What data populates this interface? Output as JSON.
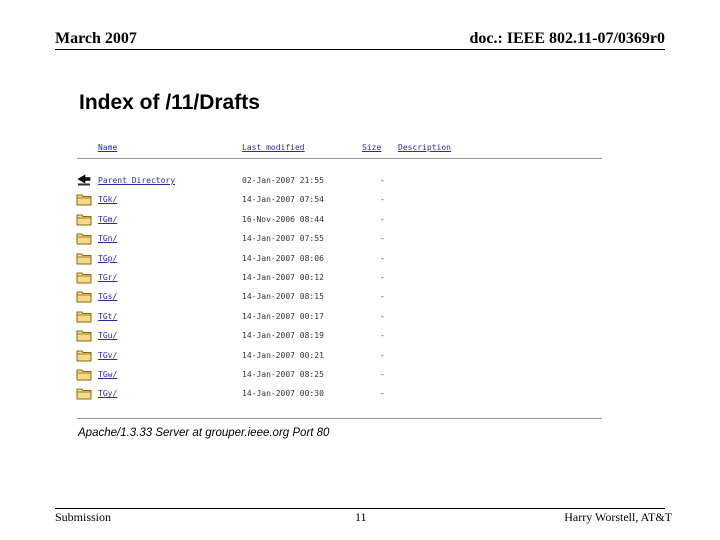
{
  "slide_header": {
    "date": "March 2007",
    "doc_id": "doc.: IEEE 802.11-07/0369r0"
  },
  "index_page": {
    "title": "Index of /11/Drafts",
    "columns": {
      "name": "Name",
      "last_modified": "Last modified",
      "size": "Size",
      "description": "Description"
    },
    "rows": [
      {
        "name": "Parent Directory",
        "modified": "02-Jan-2007 21:55",
        "size": "-",
        "icon": "back-arrow-icon"
      },
      {
        "name": "TGk/",
        "modified": "14-Jan-2007 07:54",
        "size": "-",
        "icon": "folder-icon"
      },
      {
        "name": "TGm/",
        "modified": "16-Nov-2006 08:44",
        "size": "-",
        "icon": "folder-icon"
      },
      {
        "name": "TGn/",
        "modified": "14-Jan-2007 07:55",
        "size": "-",
        "icon": "folder-icon"
      },
      {
        "name": "TGp/",
        "modified": "14-Jan-2007 08:06",
        "size": "-",
        "icon": "folder-icon"
      },
      {
        "name": "TGr/",
        "modified": "14-Jan-2007 00:12",
        "size": "-",
        "icon": "folder-icon"
      },
      {
        "name": "TGs/",
        "modified": "14-Jan-2007 08:15",
        "size": "-",
        "icon": "folder-icon"
      },
      {
        "name": "TGt/",
        "modified": "14-Jan-2007 00:17",
        "size": "-",
        "icon": "folder-icon"
      },
      {
        "name": "TGu/",
        "modified": "14-Jan-2007 08:19",
        "size": "-",
        "icon": "folder-icon"
      },
      {
        "name": "TGv/",
        "modified": "14-Jan-2007 00:21",
        "size": "-",
        "icon": "folder-icon"
      },
      {
        "name": "TGw/",
        "modified": "14-Jan-2007 08:25",
        "size": "-",
        "icon": "folder-icon"
      },
      {
        "name": "TGy/",
        "modified": "14-Jan-2007 00:30",
        "size": "-",
        "icon": "folder-icon"
      }
    ],
    "server_signature": "Apache/1.3.33 Server at grouper.ieee.org Port 80"
  },
  "slide_footer": {
    "left": "Submission",
    "page_number": "11",
    "author": "Harry Worstell, AT&T"
  },
  "colors": {
    "link": "#2a2aa6",
    "folder": "#f5d98a",
    "folder_edge": "#8a6a10"
  }
}
